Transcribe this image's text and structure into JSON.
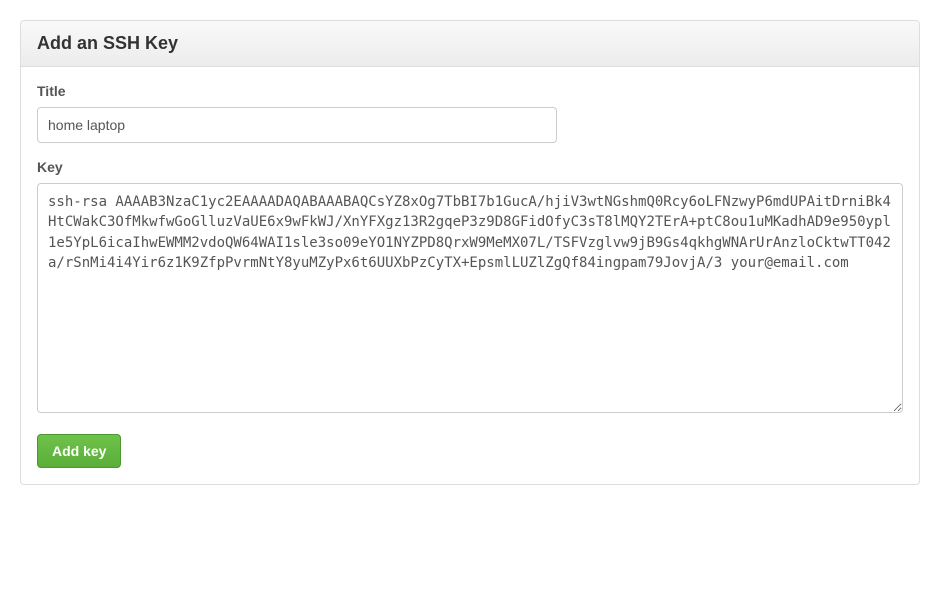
{
  "panel": {
    "title": "Add an SSH Key"
  },
  "form": {
    "title": {
      "label": "Title",
      "value": "home laptop"
    },
    "key": {
      "label": "Key",
      "value": "ssh-rsa AAAAB3NzaC1yc2EAAAADAQABAAABAQCsYZ8xOg7TbBI7b1GucA/hjiV3wtNGshmQ0Rcy6oLFNzwyP6mdUPAitDrniBk4HtCWakC3OfMkwfwGoGlluzVaUE6x9wFkWJ/XnYFXgz13R2gqeP3z9D8GFidOfyC3sT8lMQY2TErA+ptC8ou1uMKadhAD9e950ypl1e5YpL6icaIhwEWMM2vdoQW64WAI1sle3so09eYO1NYZPD8QrxW9MeMX07L/TSFVzglvw9jB9Gs4qkhgWNArUrAnzloCktwTT042a/rSnMi4i4Yir6z1K9ZfpPvrmNtY8yuMZyPx6t6UUXbPzCyTX+EpsmlLUZlZgQf84ingpam79JovjA/3 your@email.com"
    },
    "submit_label": "Add key"
  }
}
